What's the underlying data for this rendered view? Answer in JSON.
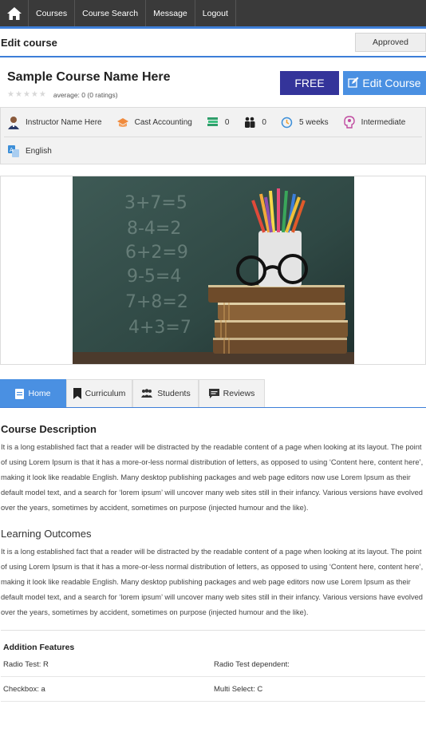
{
  "nav": {
    "items": [
      "Courses",
      "Course Search",
      "Message",
      "Logout"
    ]
  },
  "editbar": {
    "title": "Edit course",
    "status": "Approved"
  },
  "course": {
    "name": "Sample Course Name Here",
    "rating_text": "average: 0 (0 ratings)",
    "price_label": "FREE",
    "edit_label": "Edit Course"
  },
  "info": {
    "instructor": "Instructor Name Here",
    "category": "Cast Accounting",
    "lessons": "0",
    "students": "0",
    "duration": "5 weeks",
    "level": "Intermediate",
    "language": "English"
  },
  "tabs": [
    "Home",
    "Curriculum",
    "Students",
    "Reviews"
  ],
  "description": {
    "heading": "Course Description",
    "text": "It is a long established fact that a reader will be distracted by the readable content of a page when looking at its layout. The point of using Lorem Ipsum is that it has a more-or-less normal distribution of letters, as opposed to using ‘Content here, content here’, making it look like readable English. Many desktop publishing packages and web page editors now use Lorem Ipsum as their default model text, and a search for ‘lorem ipsum’ will uncover many web sites still in their infancy. Various versions have evolved over the years, sometimes by accident, sometimes on purpose (injected humour and the like)."
  },
  "outcomes": {
    "heading": "Learning Outcomes",
    "text": "It is a long established fact that a reader will be distracted by the readable content of a page when looking at its layout. The point of using Lorem Ipsum is that it has a more-or-less normal distribution of letters, as opposed to using ‘Content here, content here’, making it look like readable English. Many desktop publishing packages and web page editors now use Lorem Ipsum as their default model text, and a search for ‘lorem ipsum’ will uncover many web sites still in their infancy. Various versions have evolved over the years, sometimes by accident, sometimes on purpose (injected humour and the like)."
  },
  "features": {
    "heading": "Addition Features",
    "rows": [
      [
        "Radio Test:  R",
        "Radio Test dependent:"
      ],
      [
        "Checkbox:  a",
        "Multi Select:  C"
      ]
    ]
  },
  "colors": {
    "nav_bg": "#3a3a3a",
    "accent": "#4a90e2",
    "free_btn": "#34349a"
  }
}
